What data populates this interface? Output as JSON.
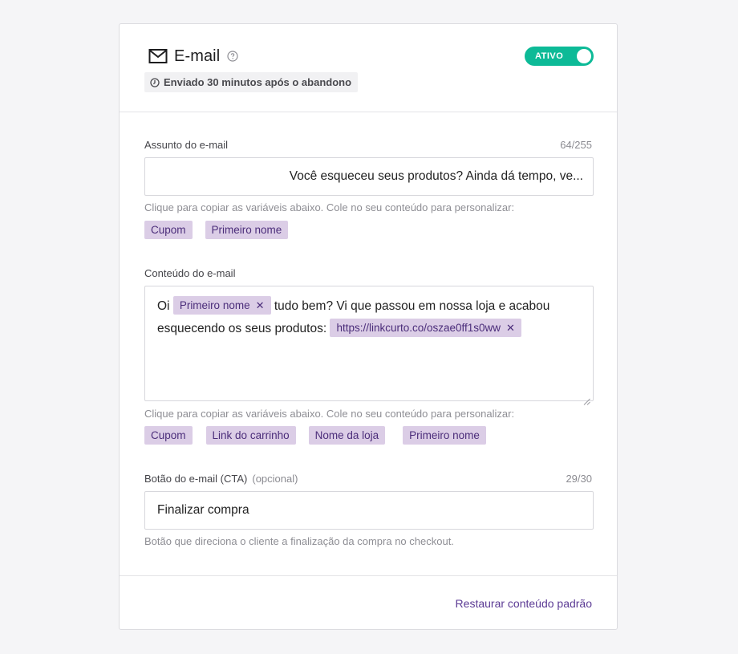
{
  "header": {
    "title": "E-mail",
    "sent_info": "Enviado 30 minutos após o abandono",
    "toggle_label": "ATIVO",
    "toggle_on": true
  },
  "subject": {
    "label": "Assunto do e-mail",
    "counter": "64/255",
    "value": "Você esqueceu seus produtos? Ainda dá tempo, ve...",
    "hint": "Clique para copiar as variáveis abaixo. Cole no seu conteúdo para personalizar:",
    "variables": [
      "Cupom",
      "Primeiro nome"
    ]
  },
  "content": {
    "label": "Conteúdo do e-mail",
    "text_1": "Oi",
    "chip_1": "Primeiro nome",
    "text_2": "tudo bem? Vi que passou em nossa loja e acabou esquecendo os seus produtos:",
    "chip_2": "https://linkcurto.co/oszae0ff1s0ww",
    "hint": "Clique para copiar as variáveis abaixo. Cole no seu conteúdo para personalizar:",
    "variables": [
      "Cupom",
      "Link do carrinho",
      "Nome da loja",
      "Primeiro nome"
    ]
  },
  "cta": {
    "label": "Botão do e-mail (CTA)",
    "optional": "(opcional)",
    "counter": "29/30",
    "value": "Finalizar compra",
    "hint": "Botão que direciona o cliente a finalização da compra no checkout."
  },
  "footer": {
    "restore_label": "Restaurar conteúdo padrão"
  },
  "colors": {
    "toggle_active": "#0dba97",
    "chip_bg": "#dbcde6",
    "chip_text": "#4b2d7a",
    "link": "#5b3a94"
  }
}
